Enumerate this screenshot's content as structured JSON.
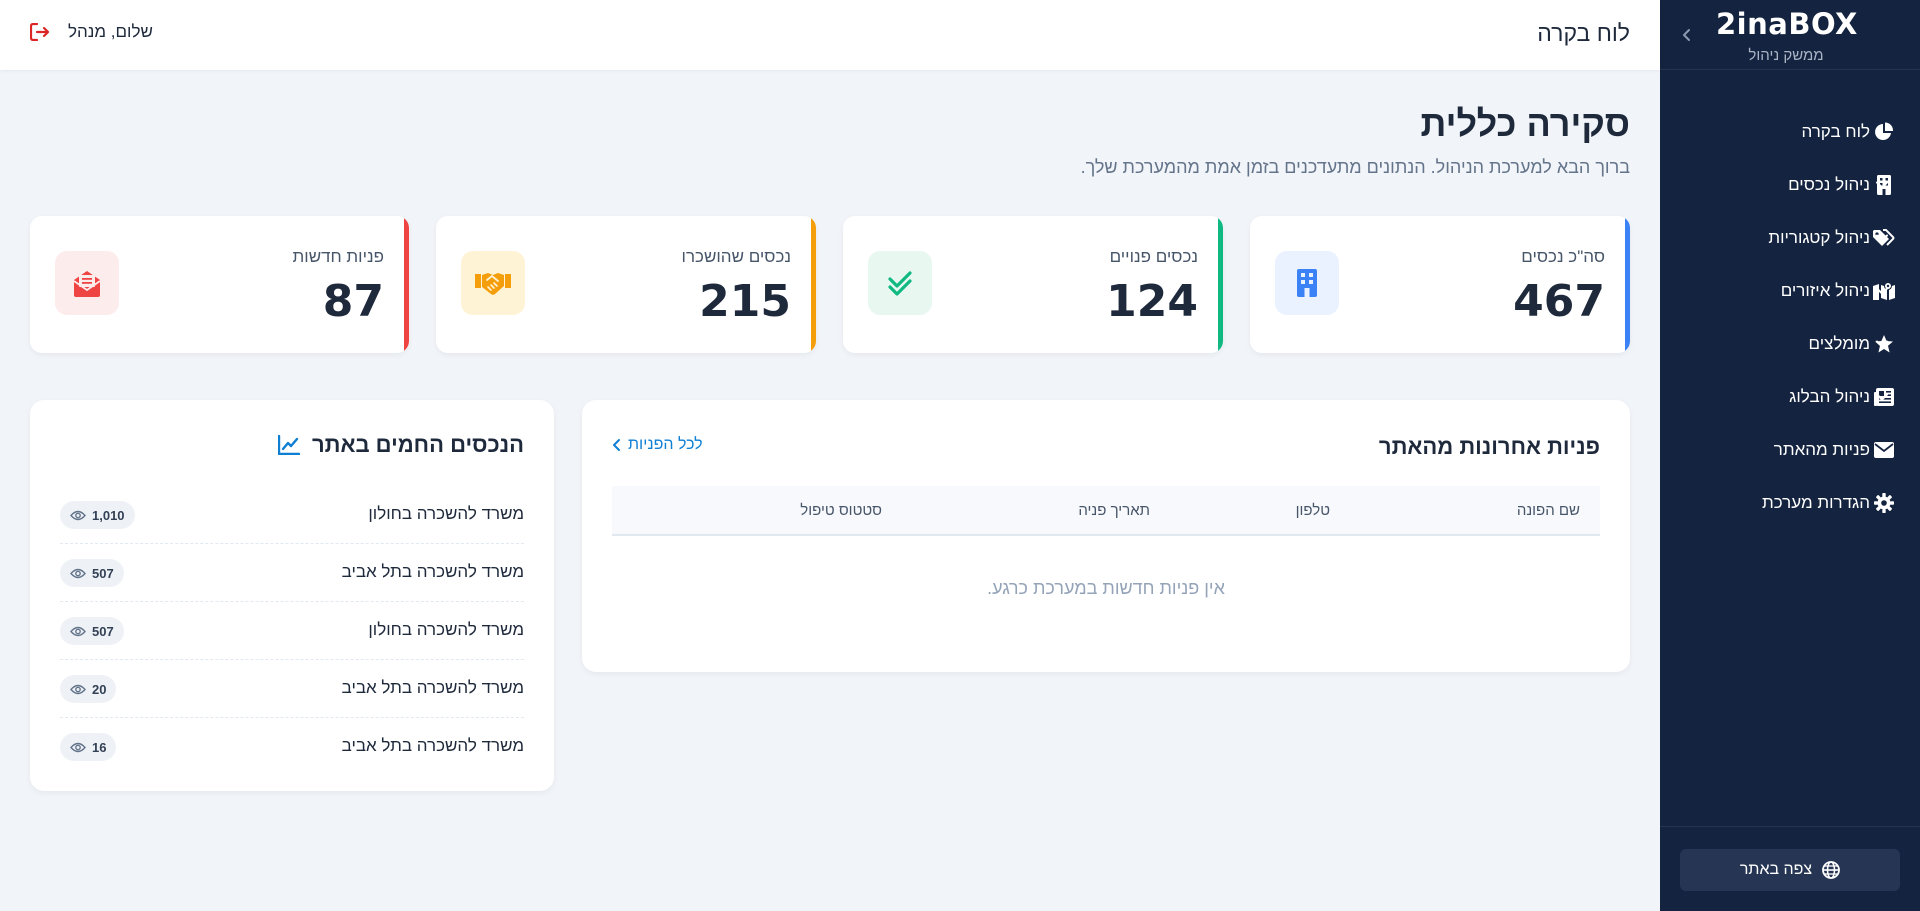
{
  "sidebar": {
    "brand": "2inaBOX",
    "subtitle": "ממשק ניהול",
    "items": [
      {
        "label": "לוח בקרה",
        "icon": "chart-pie-icon",
        "expandable": false
      },
      {
        "label": "ניהול נכסים",
        "icon": "building-icon",
        "expandable": true
      },
      {
        "label": "ניהול קטגוריות",
        "icon": "tags-icon",
        "expandable": true
      },
      {
        "label": "ניהול איזורים",
        "icon": "map-icon",
        "expandable": true
      },
      {
        "label": "מומלצים",
        "icon": "star-icon",
        "expandable": true
      },
      {
        "label": "ניהול הבלוג",
        "icon": "newspaper-icon",
        "expandable": true
      },
      {
        "label": "פניות מהאתר",
        "icon": "envelope-icon",
        "expandable": false
      },
      {
        "label": "הגדרות מערכת",
        "icon": "gear-icon",
        "expandable": false
      }
    ],
    "view_site_label": "צפה באתר"
  },
  "topbar": {
    "title": "לוח בקרה",
    "greeting": "שלום, מנהל"
  },
  "page": {
    "title": "סקירה כללית",
    "subtitle": "ברוך הבא למערכת הניהול. הנתונים מתעדכנים בזמן אמת מהמערכת שלך."
  },
  "stats": [
    {
      "label": "סה\"כ נכסים",
      "value": "467",
      "color": "#3b82f6",
      "icon_bg": "#eaf2ff",
      "icon": "building-icon"
    },
    {
      "label": "נכסים פנויים",
      "value": "124",
      "color": "#10b981",
      "icon_bg": "#e8f8f1",
      "icon": "check-icon"
    },
    {
      "label": "נכסים שהושכרו",
      "value": "215",
      "color": "#f59e0b",
      "icon_bg": "#fff3d6",
      "icon": "handshake-icon"
    },
    {
      "label": "פניות חדשות",
      "value": "87",
      "color": "#ef4444",
      "icon_bg": "#fdecec",
      "icon": "envelope-open-icon"
    }
  ],
  "inquiries": {
    "title": "פניות אחרונות מהאתר",
    "all_link": "לכל הפניות",
    "columns": [
      "שם הפונה",
      "טלפון",
      "תאריך פניה",
      "סטטוס טיפול"
    ],
    "empty_message": "אין פניות חדשות במערכת כרגע."
  },
  "hot_properties": {
    "title": "הנכסים החמים באתר",
    "items": [
      {
        "name": "משרד להשכרה בחולון",
        "views": "1,010"
      },
      {
        "name": "משרד להשכרה בתל אביב",
        "views": "507"
      },
      {
        "name": "משרד להשכרה בחולון",
        "views": "507"
      },
      {
        "name": "משרד להשכרה בתל אביב",
        "views": "20"
      },
      {
        "name": "משרד להשכרה בתל אביב",
        "views": "16"
      }
    ]
  },
  "colors": {
    "sidebar_bg": "#14233f",
    "accent_link": "#0f7fd4",
    "logout": "#dc2626"
  }
}
